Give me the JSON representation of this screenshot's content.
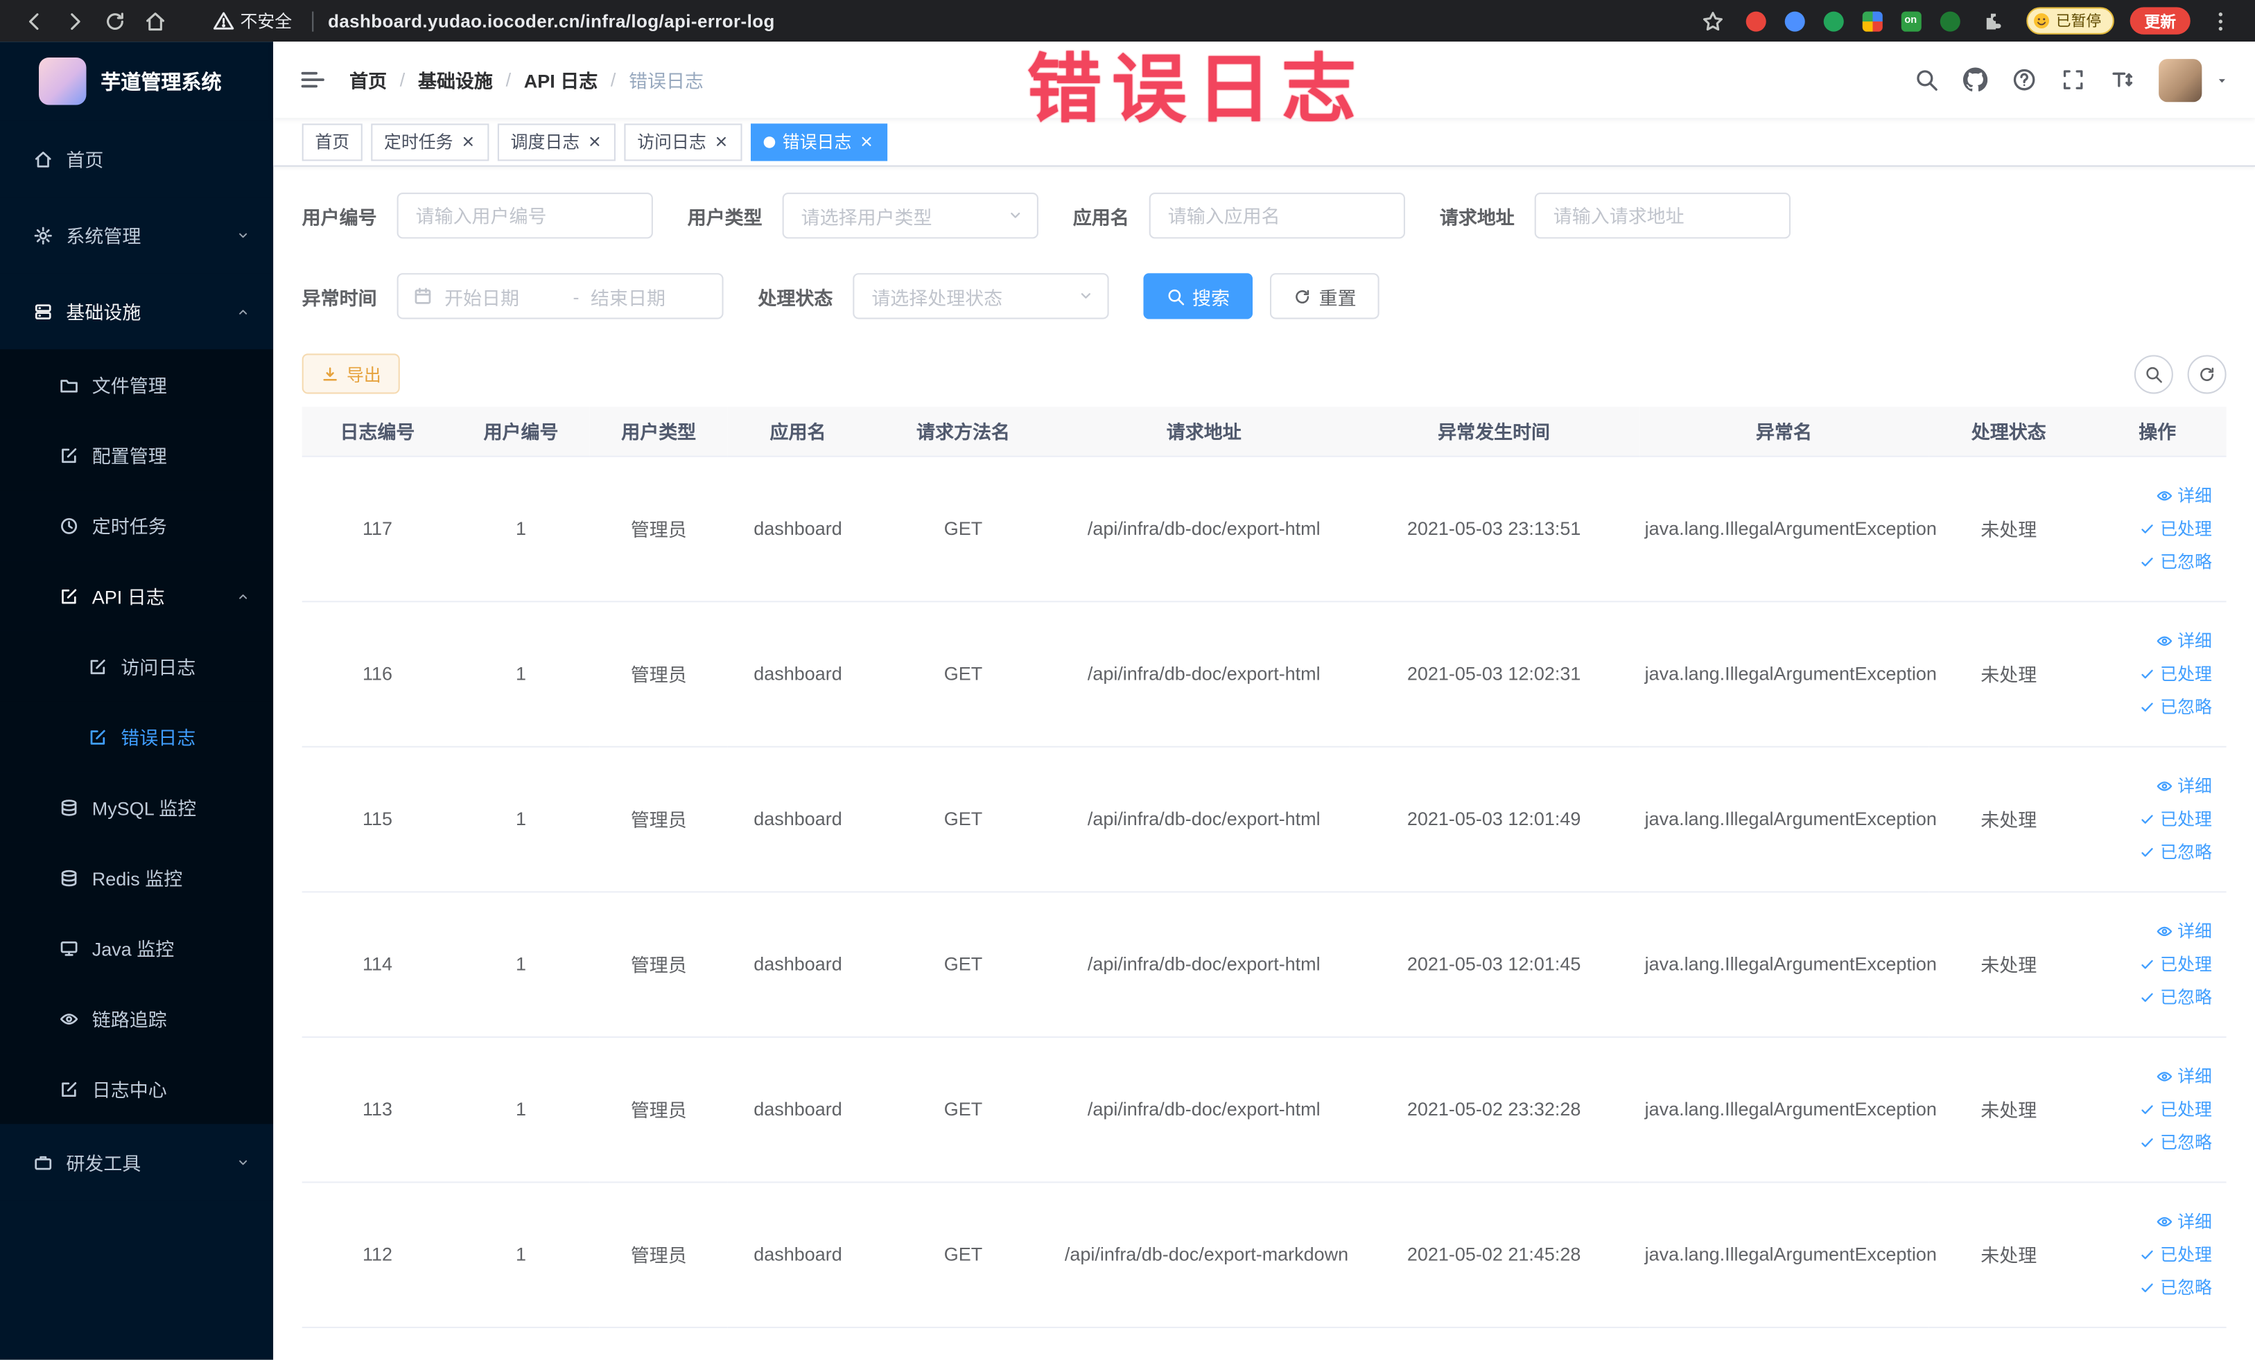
{
  "browser": {
    "security_label": "不安全",
    "url": "dashboard.yudao.iocoder.cn/infra/log/api-error-log",
    "extension_on_badge": "on",
    "extension_paused_label": "已暂停",
    "update_button_label": "更新"
  },
  "annotation_overlay": "错误日志",
  "sidebar": {
    "logo_title": "芋道管理系统",
    "items": [
      {
        "label": "首页",
        "icon": "home-icon",
        "level": 1
      },
      {
        "label": "系统管理",
        "icon": "gear-icon",
        "level": 1,
        "chevron": "down"
      },
      {
        "label": "基础设施",
        "icon": "server-icon",
        "level": 1,
        "chevron": "up",
        "open": true
      },
      {
        "label": "文件管理",
        "icon": "folder-icon",
        "level": 2
      },
      {
        "label": "配置管理",
        "icon": "edit-square-icon",
        "level": 2
      },
      {
        "label": "定时任务",
        "icon": "clock-icon",
        "level": 2
      },
      {
        "label": "API 日志",
        "icon": "edit-square-icon",
        "level": 2,
        "chevron": "up",
        "open": true
      },
      {
        "label": "访问日志",
        "icon": "edit-square-icon",
        "level": 3
      },
      {
        "label": "错误日志",
        "icon": "edit-square-icon",
        "level": 3,
        "active": true
      },
      {
        "label": "MySQL 监控",
        "icon": "database-icon",
        "level": 2
      },
      {
        "label": "Redis 监控",
        "icon": "database-icon",
        "level": 2
      },
      {
        "label": "Java 监控",
        "icon": "monitor-icon",
        "level": 2
      },
      {
        "label": "链路追踪",
        "icon": "eye-icon",
        "level": 2
      },
      {
        "label": "日志中心",
        "icon": "edit-square-icon",
        "level": 2
      },
      {
        "label": "研发工具",
        "icon": "briefcase-icon",
        "level": 1,
        "chevron": "down"
      }
    ]
  },
  "header": {
    "breadcrumb": [
      "首页",
      "基础设施",
      "API 日志",
      "错误日志"
    ]
  },
  "tags_view": [
    {
      "label": "首页",
      "closable": false,
      "active": false
    },
    {
      "label": "定时任务",
      "closable": true,
      "active": false
    },
    {
      "label": "调度日志",
      "closable": true,
      "active": false
    },
    {
      "label": "访问日志",
      "closable": true,
      "active": false
    },
    {
      "label": "错误日志",
      "closable": true,
      "active": true
    }
  ],
  "filters": {
    "user_id": {
      "label": "用户编号",
      "placeholder": "请输入用户编号"
    },
    "user_type": {
      "label": "用户类型",
      "placeholder": "请选择用户类型"
    },
    "app_name": {
      "label": "应用名",
      "placeholder": "请输入应用名"
    },
    "request_url": {
      "label": "请求地址",
      "placeholder": "请输入请求地址"
    },
    "exception_time": {
      "label": "异常时间",
      "start_placeholder": "开始日期",
      "separator": "-",
      "end_placeholder": "结束日期"
    },
    "process_status": {
      "label": "处理状态",
      "placeholder": "请选择处理状态"
    },
    "search_label": "搜索",
    "reset_label": "重置"
  },
  "toolbar": {
    "export_label": "导出"
  },
  "table": {
    "columns": [
      "日志编号",
      "用户编号",
      "用户类型",
      "应用名",
      "请求方法名",
      "请求地址",
      "异常发生时间",
      "异常名",
      "处理状态",
      "操作"
    ],
    "row_actions": [
      "详细",
      "已处理",
      "已忽略"
    ],
    "rows": [
      {
        "id": "117",
        "user_id": "1",
        "user_type": "管理员",
        "app_name": "dashboard",
        "method": "GET",
        "url": "/api/infra/db-doc/export-html",
        "time": "2021-05-03 23:13:51",
        "exception": "java.lang.IllegalArgumentException",
        "status": "未处理"
      },
      {
        "id": "116",
        "user_id": "1",
        "user_type": "管理员",
        "app_name": "dashboard",
        "method": "GET",
        "url": "/api/infra/db-doc/export-html",
        "time": "2021-05-03 12:02:31",
        "exception": "java.lang.IllegalArgumentException",
        "status": "未处理"
      },
      {
        "id": "115",
        "user_id": "1",
        "user_type": "管理员",
        "app_name": "dashboard",
        "method": "GET",
        "url": "/api/infra/db-doc/export-html",
        "time": "2021-05-03 12:01:49",
        "exception": "java.lang.IllegalArgumentException",
        "status": "未处理"
      },
      {
        "id": "114",
        "user_id": "1",
        "user_type": "管理员",
        "app_name": "dashboard",
        "method": "GET",
        "url": "/api/infra/db-doc/export-html",
        "time": "2021-05-03 12:01:45",
        "exception": "java.lang.IllegalArgumentException",
        "status": "未处理"
      },
      {
        "id": "113",
        "user_id": "1",
        "user_type": "管理员",
        "app_name": "dashboard",
        "method": "GET",
        "url": "/api/infra/db-doc/export-html",
        "time": "2021-05-02 23:32:28",
        "exception": "java.lang.IllegalArgumentException",
        "status": "未处理"
      },
      {
        "id": "112",
        "user_id": "1",
        "user_type": "管理员",
        "app_name": "dashboard",
        "method": "GET",
        "url": "/api/infra/db-doc/export-markdown",
        "time": "2021-05-02 21:45:28",
        "exception": "java.lang.IllegalArgumentException",
        "status": "未处理"
      }
    ]
  },
  "colors": {
    "primary": "#409EFF",
    "warning": "#E6A23C",
    "sidebar_bg": "#001529",
    "annotation": "#F2455D"
  }
}
